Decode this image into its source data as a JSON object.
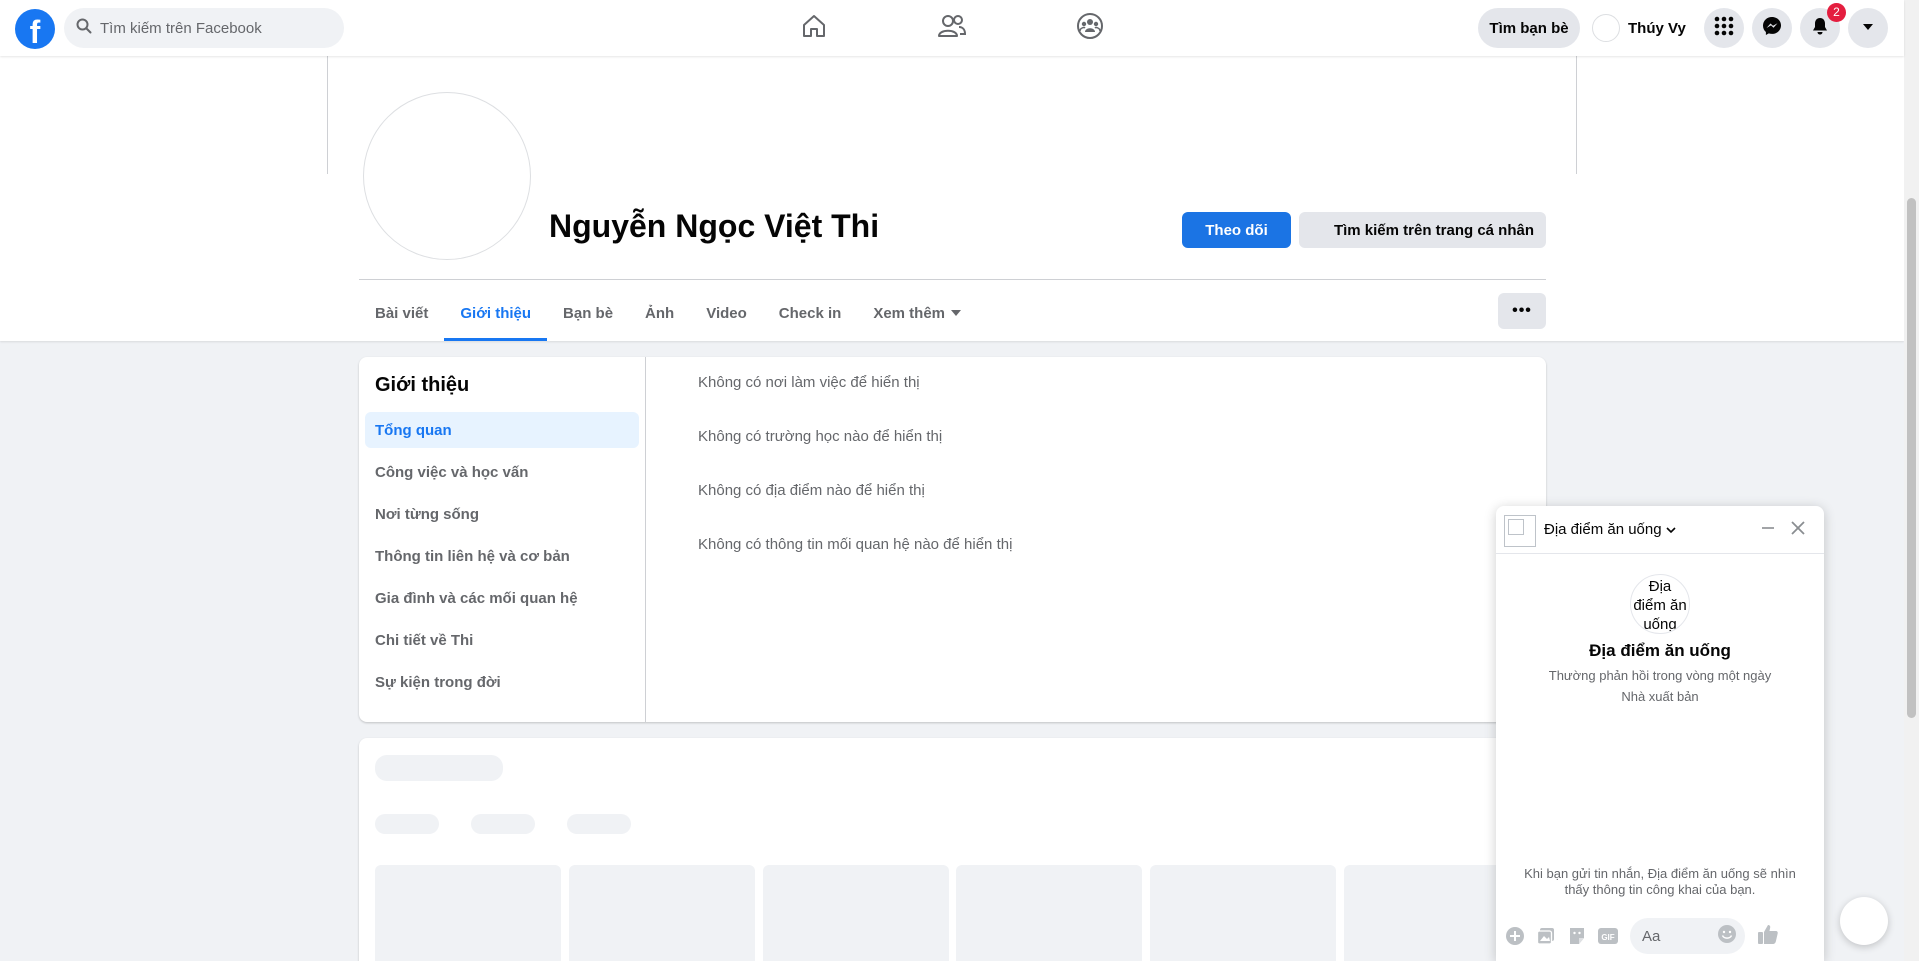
{
  "topbar": {
    "logo_letter": "f",
    "search_placeholder": "Tìm kiếm trên Facebook",
    "nav_icons": [
      "home-icon",
      "friends-icon",
      "groups-icon"
    ],
    "find_friends_label": "Tìm bạn bè",
    "user_name": "Thúy Vy",
    "notification_count": "2",
    "brand_color": "#1877f2"
  },
  "profile": {
    "name": "Nguyễn Ngọc Việt Thi",
    "follow_label": "Theo dõi",
    "search_profile_label": "Tìm kiếm trên trang cá nhân",
    "more_label": "•••",
    "tabs": [
      "Bài viết",
      "Giới thiệu",
      "Bạn bè",
      "Ảnh",
      "Video",
      "Check in",
      "Xem thêm"
    ],
    "active_tab": "Giới thiệu"
  },
  "about": {
    "title": "Giới thiệu",
    "menu": [
      "Tổng quan",
      "Công việc và học vấn",
      "Nơi từng sống",
      "Thông tin liên hệ và cơ bản",
      "Gia đình và các mối quan hệ",
      "Chi tiết về Thi",
      "Sự kiện trong đời"
    ],
    "active_menu": "Tổng quan",
    "overview_lines": [
      "Không có nơi làm việc để hiển thị",
      "Không có trường học nào để hiển thị",
      "Không có địa điểm nào để hiển thị",
      "Không có thông tin mối quan hệ nào để hiển thị"
    ]
  },
  "chat": {
    "page_name": "Địa điểm ăn uống",
    "avatar_alt": "Địa điểm ăn uống",
    "title": "Địa điểm ăn uống",
    "response_time": "Thường phản hồi trong vòng một ngày",
    "category": "Nhà xuất bản",
    "notice": "Khi bạn gửi tin nhắn, Địa điểm ăn uống sẽ nhìn thấy thông tin công khai của bạn.",
    "input_placeholder": "Aa",
    "footer_icons": [
      "plus-circle-icon",
      "photo-icon",
      "sticker-icon",
      "gif-icon"
    ],
    "gif_label": "GIF"
  }
}
